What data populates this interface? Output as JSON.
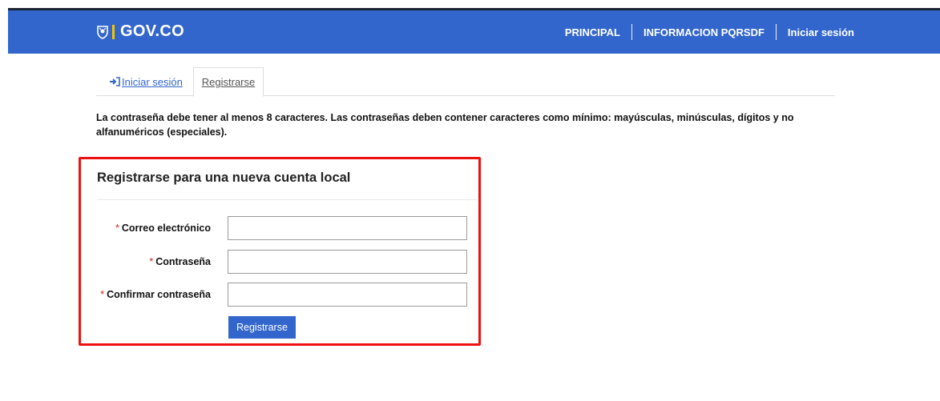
{
  "header": {
    "brand": "GOV.CO",
    "brand_accent_color": "#f3c700",
    "bar_color": "#3366cc",
    "nav": [
      {
        "label": "PRINCIPAL"
      },
      {
        "label": "INFORMACION PQRSDF"
      },
      {
        "label": "Iniciar sesión"
      }
    ]
  },
  "tabs": {
    "login": {
      "label": "Iniciar sesión",
      "icon": "sign-in-icon"
    },
    "register": {
      "label": "Registrarse"
    }
  },
  "notice": "La contraseña debe tener al menos 8 caracteres. Las contraseñas deben contener caracteres como mínimo: mayúsculas, minúsculas, dígitos y no alfanuméricos (especiales).",
  "form": {
    "title": "Registrarse para una nueva cuenta local",
    "required_mark": "*",
    "fields": [
      {
        "label": "Correo electrónico",
        "value": "",
        "placeholder": ""
      },
      {
        "label": "Contraseña",
        "value": "",
        "placeholder": ""
      },
      {
        "label": "Confirmar contraseña",
        "value": "",
        "placeholder": ""
      }
    ],
    "submit_label": "Registrarse",
    "highlight_color": "#ee1111"
  }
}
